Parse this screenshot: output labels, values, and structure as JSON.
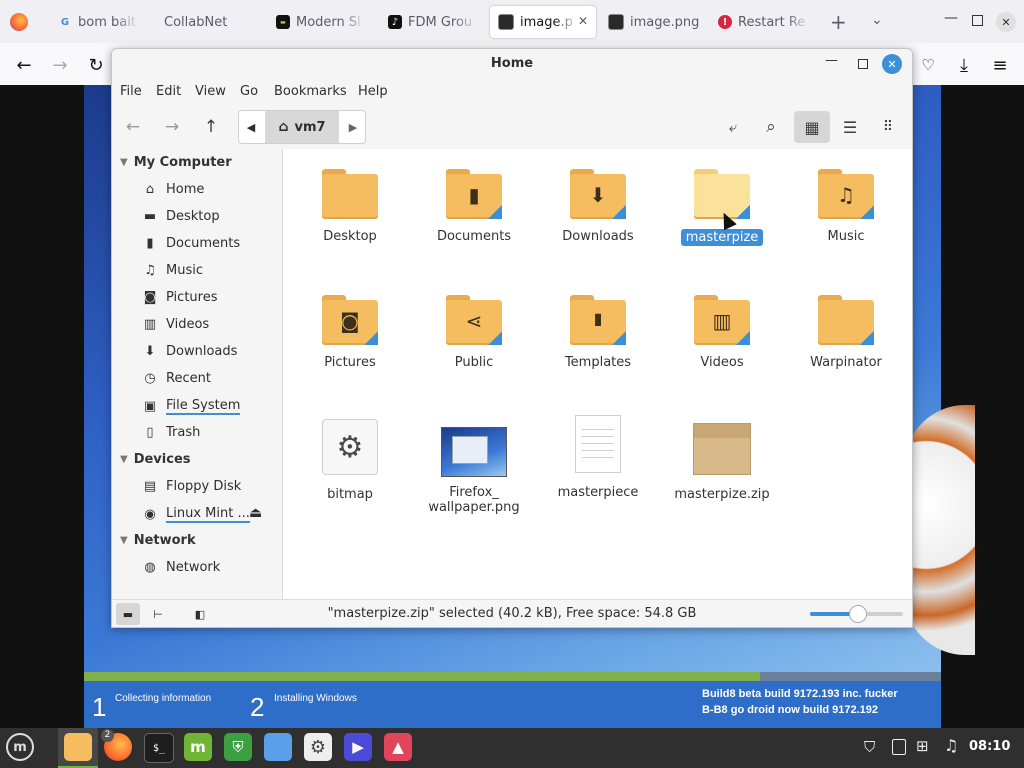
{
  "browser": {
    "tabs": [
      {
        "label": "bom bait -",
        "icon": "google-icon"
      },
      {
        "label": "CollabNet",
        "icon": "collabnet-icon"
      },
      {
        "label": "Modern Sl",
        "icon": "page-icon"
      },
      {
        "label": "FDM Grou",
        "icon": "tiktok-icon"
      },
      {
        "label": "image.p",
        "icon": "image-icon",
        "active": true
      },
      {
        "label": "image.png",
        "icon": "image-icon"
      },
      {
        "label": "Restart Re",
        "icon": "alert-icon"
      }
    ]
  },
  "window": {
    "title": "Home",
    "menus": [
      "File",
      "Edit",
      "View",
      "Go",
      "Bookmarks",
      "Help"
    ],
    "path_label": "vm7"
  },
  "sidebar": {
    "sections": [
      {
        "label": "My Computer",
        "items": [
          {
            "label": "Home",
            "icon": "home-icon"
          },
          {
            "label": "Desktop",
            "icon": "desktop-icon"
          },
          {
            "label": "Documents",
            "icon": "document-icon"
          },
          {
            "label": "Music",
            "icon": "music-icon"
          },
          {
            "label": "Pictures",
            "icon": "camera-icon"
          },
          {
            "label": "Videos",
            "icon": "film-icon"
          },
          {
            "label": "Downloads",
            "icon": "download-icon"
          },
          {
            "label": "Recent",
            "icon": "clock-icon"
          },
          {
            "label": "File System",
            "icon": "drive-icon"
          },
          {
            "label": "Trash",
            "icon": "trash-icon"
          }
        ]
      },
      {
        "label": "Devices",
        "items": [
          {
            "label": "Floppy Disk",
            "icon": "floppy-icon"
          },
          {
            "label": "Linux Mint ...",
            "icon": "disc-icon"
          }
        ]
      },
      {
        "label": "Network",
        "items": [
          {
            "label": "Network",
            "icon": "globe-icon"
          }
        ]
      }
    ]
  },
  "files": [
    {
      "name": "Desktop",
      "kind": "folder",
      "emblem": ""
    },
    {
      "name": "Documents",
      "kind": "folder",
      "emblem": "document"
    },
    {
      "name": "Downloads",
      "kind": "folder",
      "emblem": "download"
    },
    {
      "name": "masterpize",
      "kind": "folder",
      "emblem": "",
      "selected": true
    },
    {
      "name": "Music",
      "kind": "folder",
      "emblem": "music"
    },
    {
      "name": "Pictures",
      "kind": "folder",
      "emblem": "camera"
    },
    {
      "name": "Public",
      "kind": "folder",
      "emblem": "share"
    },
    {
      "name": "Templates",
      "kind": "folder",
      "emblem": "template"
    },
    {
      "name": "Videos",
      "kind": "folder",
      "emblem": "film"
    },
    {
      "name": "Warpinator",
      "kind": "folder",
      "emblem": ""
    },
    {
      "name": "bitmap",
      "kind": "settings-file"
    },
    {
      "name_line1": "Firefox_",
      "name_line2": "wallpaper.png",
      "kind": "image"
    },
    {
      "name": "masterpiece",
      "kind": "text-file"
    },
    {
      "name": "masterpize.zip",
      "kind": "archive"
    }
  ],
  "status": {
    "text": "\"masterpize.zip\" selected (40.2 kB), Free space: 54.8 GB",
    "zoom_fraction": 0.5
  },
  "wallpaper": {
    "step1_num": "1",
    "step1_label": "Collecting information",
    "step2_num": "2",
    "step2_label": "Installing Windows",
    "build_line1": "Build8 beta build 9172.193 inc. fucker",
    "build_line2": "B-B8 go droid now build 9172.192"
  },
  "taskbar": {
    "firefox_badge": "2",
    "clock": "08:10"
  },
  "colors": {
    "accent": "#3d8fd8",
    "folder": "#f6bd60",
    "mint_green": "#6fb636"
  }
}
